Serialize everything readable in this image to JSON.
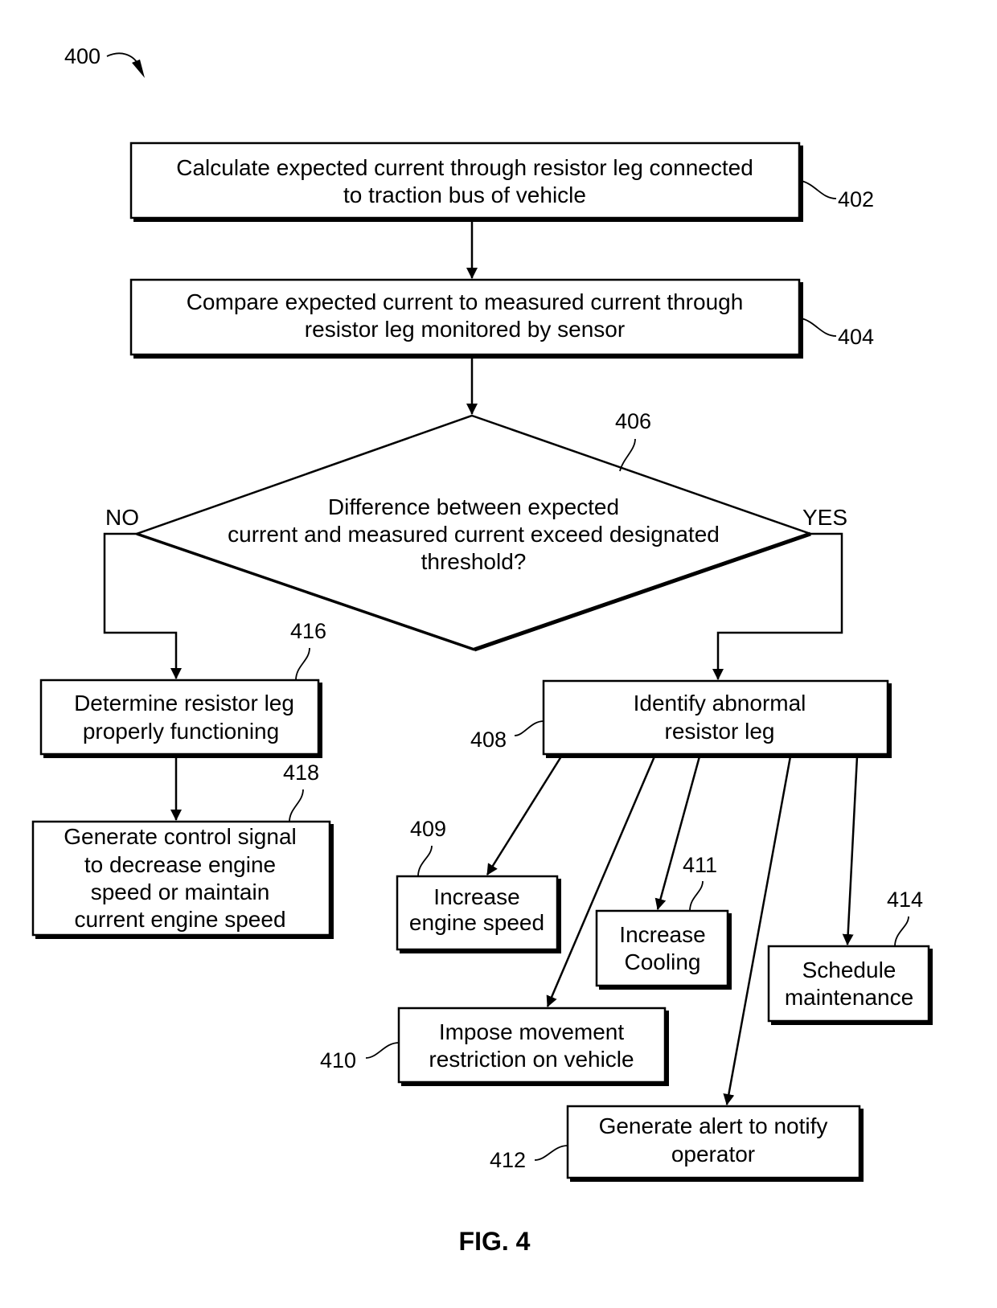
{
  "figure": {
    "ref": "400",
    "caption": "FIG. 4"
  },
  "steps": {
    "s402": {
      "ref": "402",
      "lines": [
        "Calculate expected current through resistor leg connected",
        "to traction bus of vehicle"
      ]
    },
    "s404": {
      "ref": "404",
      "lines": [
        "Compare expected current to measured current through",
        "resistor leg monitored by sensor"
      ]
    },
    "s406": {
      "ref": "406",
      "lines": [
        "Difference between expected",
        "current and measured current exceed designated",
        "threshold?"
      ],
      "no_label": "NO",
      "yes_label": "YES"
    },
    "s416": {
      "ref": "416",
      "lines": [
        "Determine resistor leg",
        "properly functioning"
      ]
    },
    "s418": {
      "ref": "418",
      "lines": [
        "Generate control signal",
        "to decrease engine",
        "speed or maintain",
        "current engine speed"
      ]
    },
    "s408": {
      "ref": "408",
      "lines": [
        "Identify abnormal",
        "resistor leg"
      ]
    },
    "s409": {
      "ref": "409",
      "lines": [
        "Increase",
        "engine speed"
      ]
    },
    "s411": {
      "ref": "411",
      "lines": [
        "Increase",
        "Cooling"
      ]
    },
    "s414": {
      "ref": "414",
      "lines": [
        "Schedule",
        "maintenance"
      ]
    },
    "s410": {
      "ref": "410",
      "lines": [
        "Impose movement",
        "restriction on vehicle"
      ]
    },
    "s412": {
      "ref": "412",
      "lines": [
        "Generate alert to notify",
        "operator"
      ]
    }
  }
}
